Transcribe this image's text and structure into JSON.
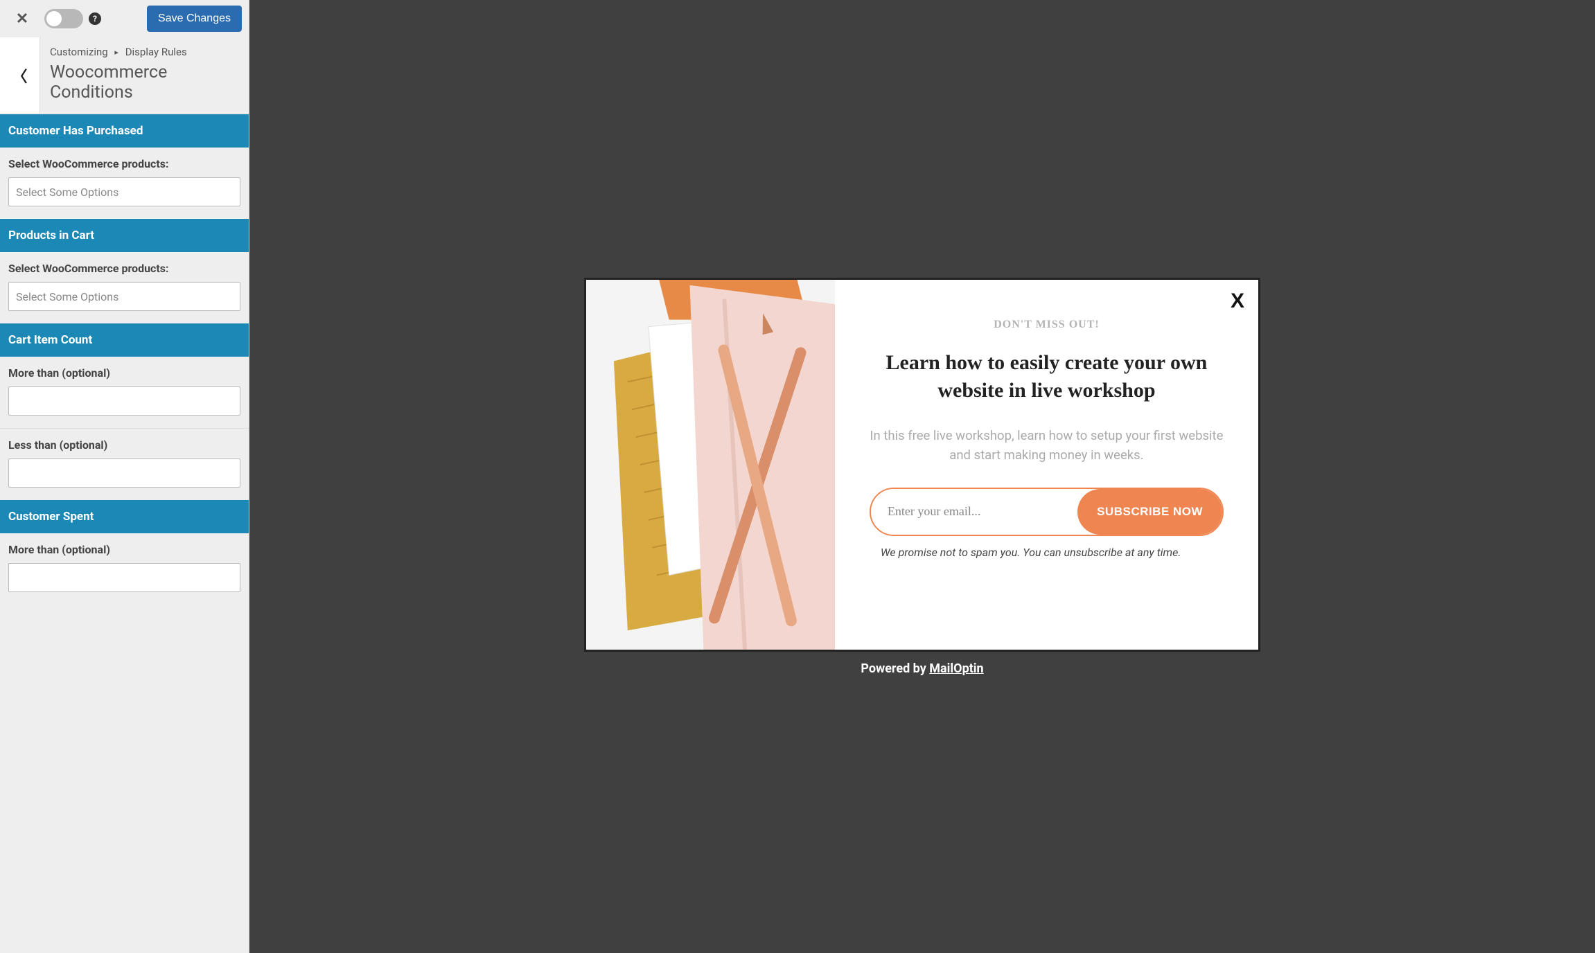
{
  "topbar": {
    "save_label": "Save Changes",
    "help_symbol": "?"
  },
  "breadcrumb": {
    "root": "Customizing",
    "sep": "▸",
    "parent": "Display Rules",
    "title": "Woocommerce Conditions"
  },
  "sections": {
    "purchased": {
      "header": "Customer Has Purchased",
      "field_label": "Select WooCommerce products:",
      "placeholder": "Select Some Options"
    },
    "in_cart": {
      "header": "Products in Cart",
      "field_label": "Select WooCommerce products:",
      "placeholder": "Select Some Options"
    },
    "item_count": {
      "header": "Cart Item Count",
      "more_label": "More than (optional)",
      "less_label": "Less than (optional)",
      "more_value": "",
      "less_value": ""
    },
    "spent": {
      "header": "Customer Spent",
      "more_label": "More than (optional)",
      "more_value": ""
    }
  },
  "modal": {
    "eyebrow": "DON'T MISS OUT!",
    "headline": "Learn how to easily create your own website in live workshop",
    "subhead": "In this free live workshop, learn how to setup your first website and start making money in weeks.",
    "email_placeholder": "Enter your email...",
    "submit_label": "SUBSCRIBE NOW",
    "disclaimer": "We promise not to spam you. You can unsubscribe at any time.",
    "close_symbol": "X"
  },
  "powered": {
    "prefix": "Powered by ",
    "brand": "MailOptin"
  },
  "colors": {
    "accent_blue": "#1c88b5",
    "button_blue": "#2b6cb0",
    "accent_orange": "#ef8550",
    "preview_bg": "#404040"
  }
}
